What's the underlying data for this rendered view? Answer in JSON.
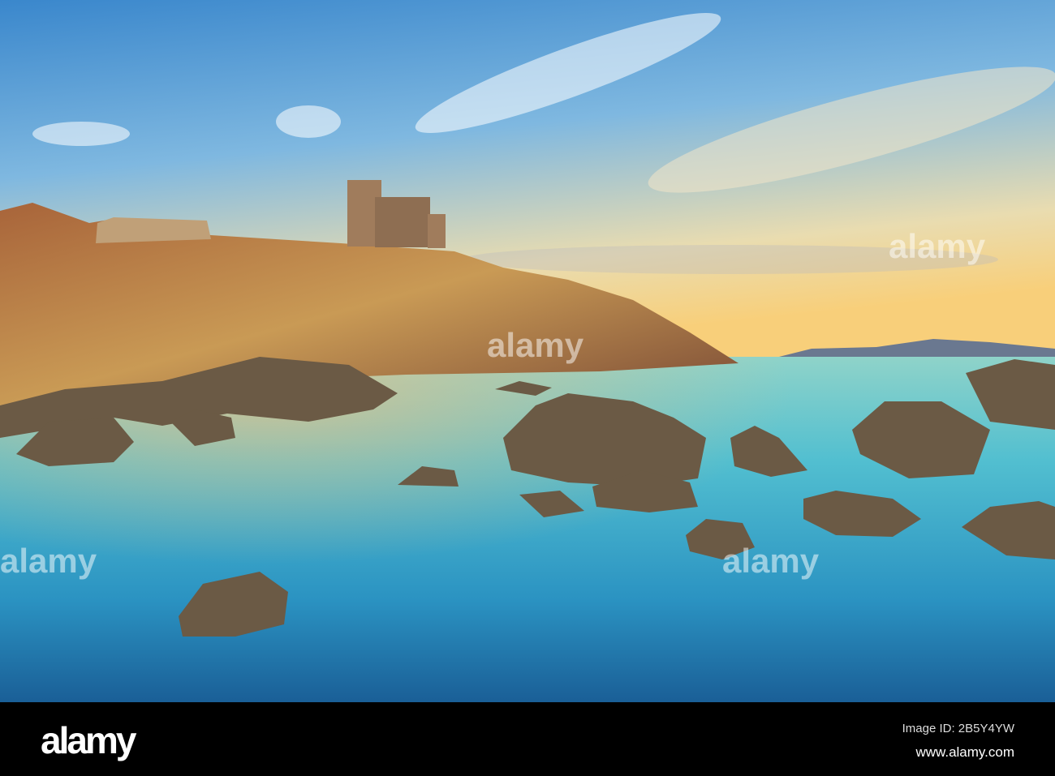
{
  "photo": {
    "subject": "Talamone castle on rocky coast at sunset",
    "colors": {
      "sky_top": "#3f8fd0",
      "sky_horizon": "#f6d38a",
      "sea": "#3fb3c8",
      "sea_deep": "#1d6fa6",
      "cliff": "#b07a45"
    }
  },
  "watermarks": [
    "alamy",
    "alamy",
    "alamy",
    "alamy",
    "alamy",
    "alamy",
    "alamy",
    "alamy"
  ],
  "footer": {
    "logo": "alamy",
    "image_id": "Image ID: 2B5Y4YW",
    "website": "www.alamy.com"
  }
}
